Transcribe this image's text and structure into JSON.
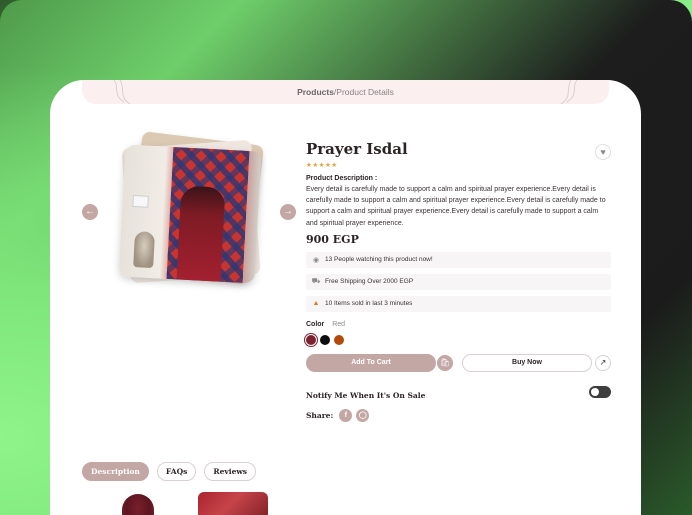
{
  "breadcrumb": {
    "home": "Products",
    "current": " /Product Details"
  },
  "product": {
    "title": "Prayer Isdal",
    "stars": "★★★★★",
    "description_label": "Product Description :",
    "description": "Every detail is carefully made to support a calm and spiritual prayer experience.Every detail is carefully made to support a calm and spiritual prayer experience.Every detail is carefully made to support a calm and spiritual prayer experience.Every detail is carefully made to support a calm and spiritual prayer experience.",
    "price": "900 EGP"
  },
  "info_rows": [
    {
      "icon": "eye-icon",
      "text": "13 People watching this product now!"
    },
    {
      "icon": "truck-icon",
      "text": "Free Shipping Over 2000 EGP"
    },
    {
      "icon": "fire-icon",
      "text": "10 Items sold in last 3 minutes"
    }
  ],
  "color": {
    "label": "Color",
    "selected_value": "Red",
    "swatches": [
      "#7b2231",
      "#0d0d0d",
      "#b34a0c"
    ]
  },
  "actions": {
    "add_to_cart": "Add To Cart",
    "buy_now": "Buy Now"
  },
  "notify": {
    "label": "Notify Me When It's On Sale"
  },
  "share": {
    "label": "Share:"
  },
  "tabs": [
    "Description",
    "FAQs",
    "Reviews"
  ],
  "colors": {
    "accent": "#c2a7a4",
    "breadcrumb_bg": "#fbeff0",
    "text": "#2b2324"
  }
}
